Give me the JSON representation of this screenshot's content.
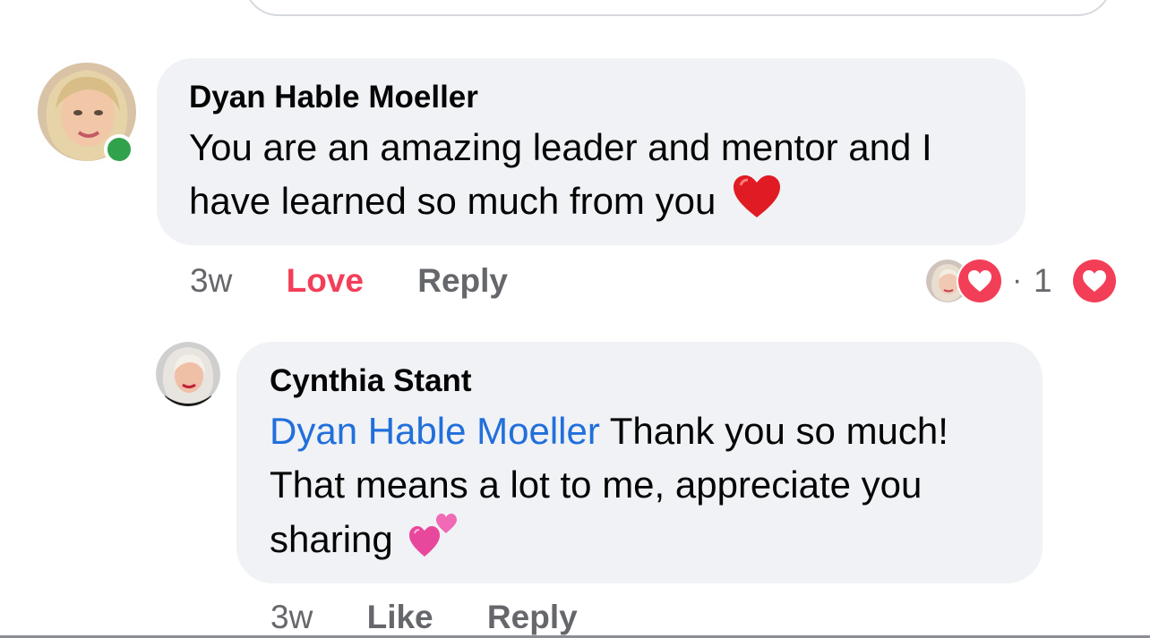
{
  "comments": [
    {
      "author": "Dyan Hable Moeller",
      "text": "You are an amazing leader and mentor and I have learned so much from you",
      "emoji": "red-heart-emoji",
      "time": "3w",
      "react_label": "Love",
      "reply_label": "Reply",
      "reaction_dot": "·",
      "reaction_count": "1",
      "online": true
    },
    {
      "author": "Cynthia Stant",
      "mention": "Dyan Hable Moeller",
      "text": " Thank you so much! That means a lot to me, appreciate you sharing",
      "emoji": "two-hearts-emoji",
      "time": "3w",
      "like_label": "Like",
      "reply_label": "Reply"
    }
  ],
  "colors": {
    "bubble": "#f0f2f5",
    "love": "#f33e58",
    "mention": "#216fdb",
    "meta": "#65676b",
    "online": "#31a24c"
  }
}
